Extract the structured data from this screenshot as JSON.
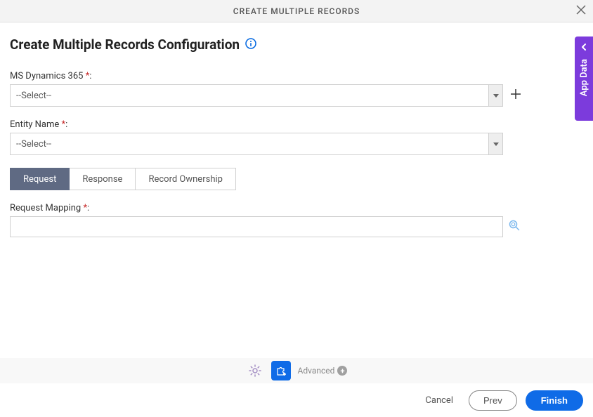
{
  "header": {
    "title": "CREATE MULTIPLE RECORDS"
  },
  "page": {
    "title": "Create Multiple Records Configuration"
  },
  "fields": {
    "dynamics": {
      "label": "MS Dynamics 365",
      "selected": "--Select--"
    },
    "entity": {
      "label": "Entity Name",
      "selected": "--Select--"
    },
    "mapping": {
      "label": "Request Mapping",
      "value": ""
    }
  },
  "tabs": [
    {
      "label": "Request"
    },
    {
      "label": "Response"
    },
    {
      "label": "Record Ownership"
    }
  ],
  "bottom": {
    "advanced": "Advanced",
    "cancel": "Cancel",
    "prev": "Prev",
    "finish": "Finish"
  },
  "side": {
    "label": "App Data"
  }
}
